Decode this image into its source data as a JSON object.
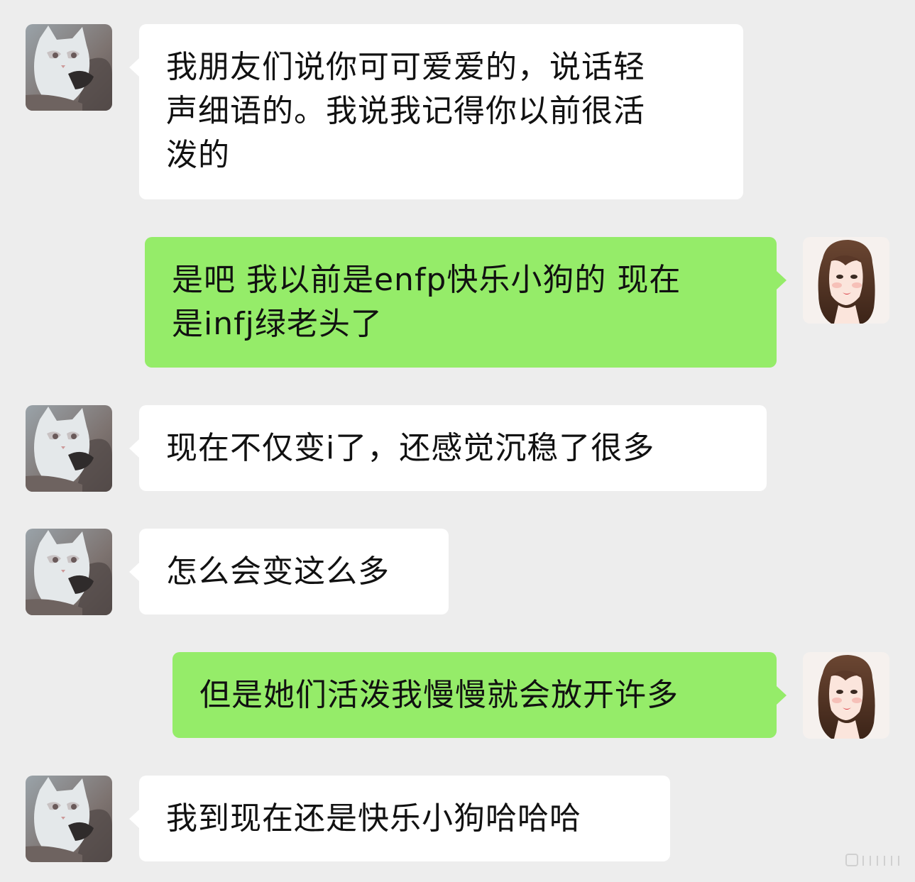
{
  "chat": {
    "messages": [
      {
        "sender": "friend",
        "lines": [
          "我朋友们说你可可爱爱的，说话轻",
          "声细语的。我说我记得你以前很活",
          "泼的"
        ]
      },
      {
        "sender": "me",
        "lines": [
          "是吧 我以前是enfp快乐小狗的 现在",
          "是infj绿老头了"
        ]
      },
      {
        "sender": "friend",
        "lines": [
          "现在不仅变i了，还感觉沉稳了很多"
        ]
      },
      {
        "sender": "friend",
        "lines": [
          "怎么会变这么多"
        ]
      },
      {
        "sender": "me",
        "lines": [
          "但是她们活泼我慢慢就会放开许多"
        ]
      },
      {
        "sender": "friend",
        "lines": [
          "我到现在还是快乐小狗哈哈哈"
        ]
      }
    ]
  },
  "avatars": {
    "friend": "cat-photo-avatar",
    "me": "illustrated-girl-avatar"
  },
  "colors": {
    "background": "#ededed",
    "incoming_bubble": "#ffffff",
    "outgoing_bubble": "#95ec69",
    "text": "#111111"
  }
}
